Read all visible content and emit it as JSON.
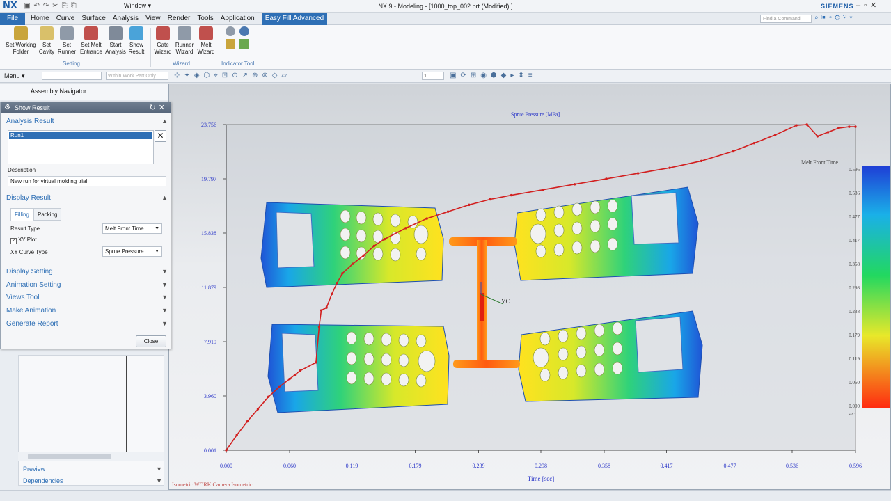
{
  "titlebar": {
    "logo": "NX",
    "window_menu": "Window ▾",
    "title": "NX 9 - Modeling - [1000_top_002.prt (Modified) ]",
    "brand": "SIEMENS"
  },
  "menubar": {
    "file": "File",
    "items": [
      "Home",
      "Curve",
      "Surface",
      "Analysis",
      "View",
      "Render",
      "Tools",
      "Application"
    ],
    "active": "Easy Fill Advanced",
    "find_placeholder": "Find a Command"
  },
  "ribbon": {
    "setting_buttons": [
      {
        "label": "Set Working Folder",
        "icon": "folder-icon",
        "color": "#c9a53c"
      },
      {
        "label": "Set Cavity",
        "icon": "cavity-icon",
        "color": "#d9c06a"
      },
      {
        "label": "Set Runner",
        "icon": "runner-icon",
        "color": "#8f9aa8"
      },
      {
        "label": "Set Melt Entrance",
        "icon": "melt-entrance-icon",
        "color": "#c0504d"
      },
      {
        "label": "Start Analysis",
        "icon": "analysis-icon",
        "color": "#7f8a99"
      },
      {
        "label": "Show Result",
        "icon": "result-icon",
        "color": "#4aa3d9"
      }
    ],
    "wizard_buttons": [
      {
        "label": "Gate Wizard",
        "icon": "gate-wizard-icon",
        "color": "#c0504d"
      },
      {
        "label": "Runner Wizard",
        "icon": "runner-wizard-icon",
        "color": "#8f9aa8"
      },
      {
        "label": "Melt Wizard",
        "icon": "melt-wizard-icon",
        "color": "#c0504d"
      }
    ],
    "group_setting": "Setting",
    "group_wizard": "Wizard",
    "group_indicator": "Indicator Tool"
  },
  "toolbar2": {
    "menu": "Menu ▾",
    "filter_placeholder": "Within Work Part Only",
    "scale": "1"
  },
  "navigator": {
    "title": "Assembly Navigator"
  },
  "dialog": {
    "title": "Show Result",
    "analysis_result": "Analysis Result",
    "run_item": "Run1",
    "description_label": "Description",
    "description_value": "New run for virtual molding trial",
    "display_result": "Display Result",
    "tab_filling": "Filling",
    "tab_packing": "Packing",
    "result_type_label": "Result Type",
    "result_type_value": "Melt Front Time",
    "xy_plot_label": "XY Plot",
    "xy_curve_type_label": "XY Curve Type",
    "xy_curve_type_value": "Sprue Pressure",
    "collapsed_sections": [
      "Display Setting",
      "Animation Setting",
      "Views Tool",
      "Make Animation",
      "Generate Report"
    ],
    "close_label": "Close"
  },
  "bottom_sections": [
    "Preview",
    "Dependencies"
  ],
  "viewport": {
    "view_label": "Isometric WORK Camera Isometric",
    "axis_label": "YC"
  },
  "chart_data": {
    "type": "line",
    "title": "Sprue Pressure [MPa]",
    "xlabel": "Time [sec]",
    "ylabel": "",
    "xlim": [
      0.0,
      0.596
    ],
    "ylim": [
      0.001,
      23.756
    ],
    "x_ticks": [
      "0.000",
      "0.060",
      "0.119",
      "0.179",
      "0.239",
      "0.298",
      "0.358",
      "0.417",
      "0.477",
      "0.536",
      "0.596"
    ],
    "y_ticks": [
      "0.001",
      "3.960",
      "7.919",
      "11.879",
      "15.838",
      "19.797",
      "23.756"
    ],
    "series": [
      {
        "color": "#d21f1f",
        "x": [
          0.0,
          0.01,
          0.02,
          0.03,
          0.04,
          0.05,
          0.06,
          0.065,
          0.07,
          0.085,
          0.088,
          0.09,
          0.095,
          0.1,
          0.105,
          0.11,
          0.12,
          0.13,
          0.14,
          0.15,
          0.17,
          0.19,
          0.21,
          0.23,
          0.25,
          0.27,
          0.3,
          0.33,
          0.36,
          0.39,
          0.42,
          0.45,
          0.48,
          0.5,
          0.52,
          0.54,
          0.55,
          0.56,
          0.57,
          0.58,
          0.59,
          0.596
        ],
        "y": [
          0.001,
          1.1,
          2.1,
          3.0,
          3.9,
          4.6,
          5.2,
          5.5,
          5.8,
          6.4,
          9.0,
          10.2,
          10.4,
          11.4,
          12.2,
          12.9,
          13.6,
          14.2,
          14.9,
          15.4,
          16.2,
          16.9,
          17.4,
          17.9,
          18.3,
          18.6,
          19.0,
          19.4,
          19.8,
          20.2,
          20.6,
          21.1,
          21.8,
          22.4,
          23.0,
          23.7,
          23.756,
          22.9,
          23.2,
          23.5,
          23.6,
          23.6
        ]
      }
    ],
    "legend_title": "Melt Front Time",
    "legend_ticks": [
      "0.596",
      "0.536",
      "0.477",
      "0.417",
      "0.358",
      "0.298",
      "0.238",
      "0.179",
      "0.119",
      "0.060",
      "0.000"
    ],
    "legend_unit": "sec",
    "grid": false
  }
}
